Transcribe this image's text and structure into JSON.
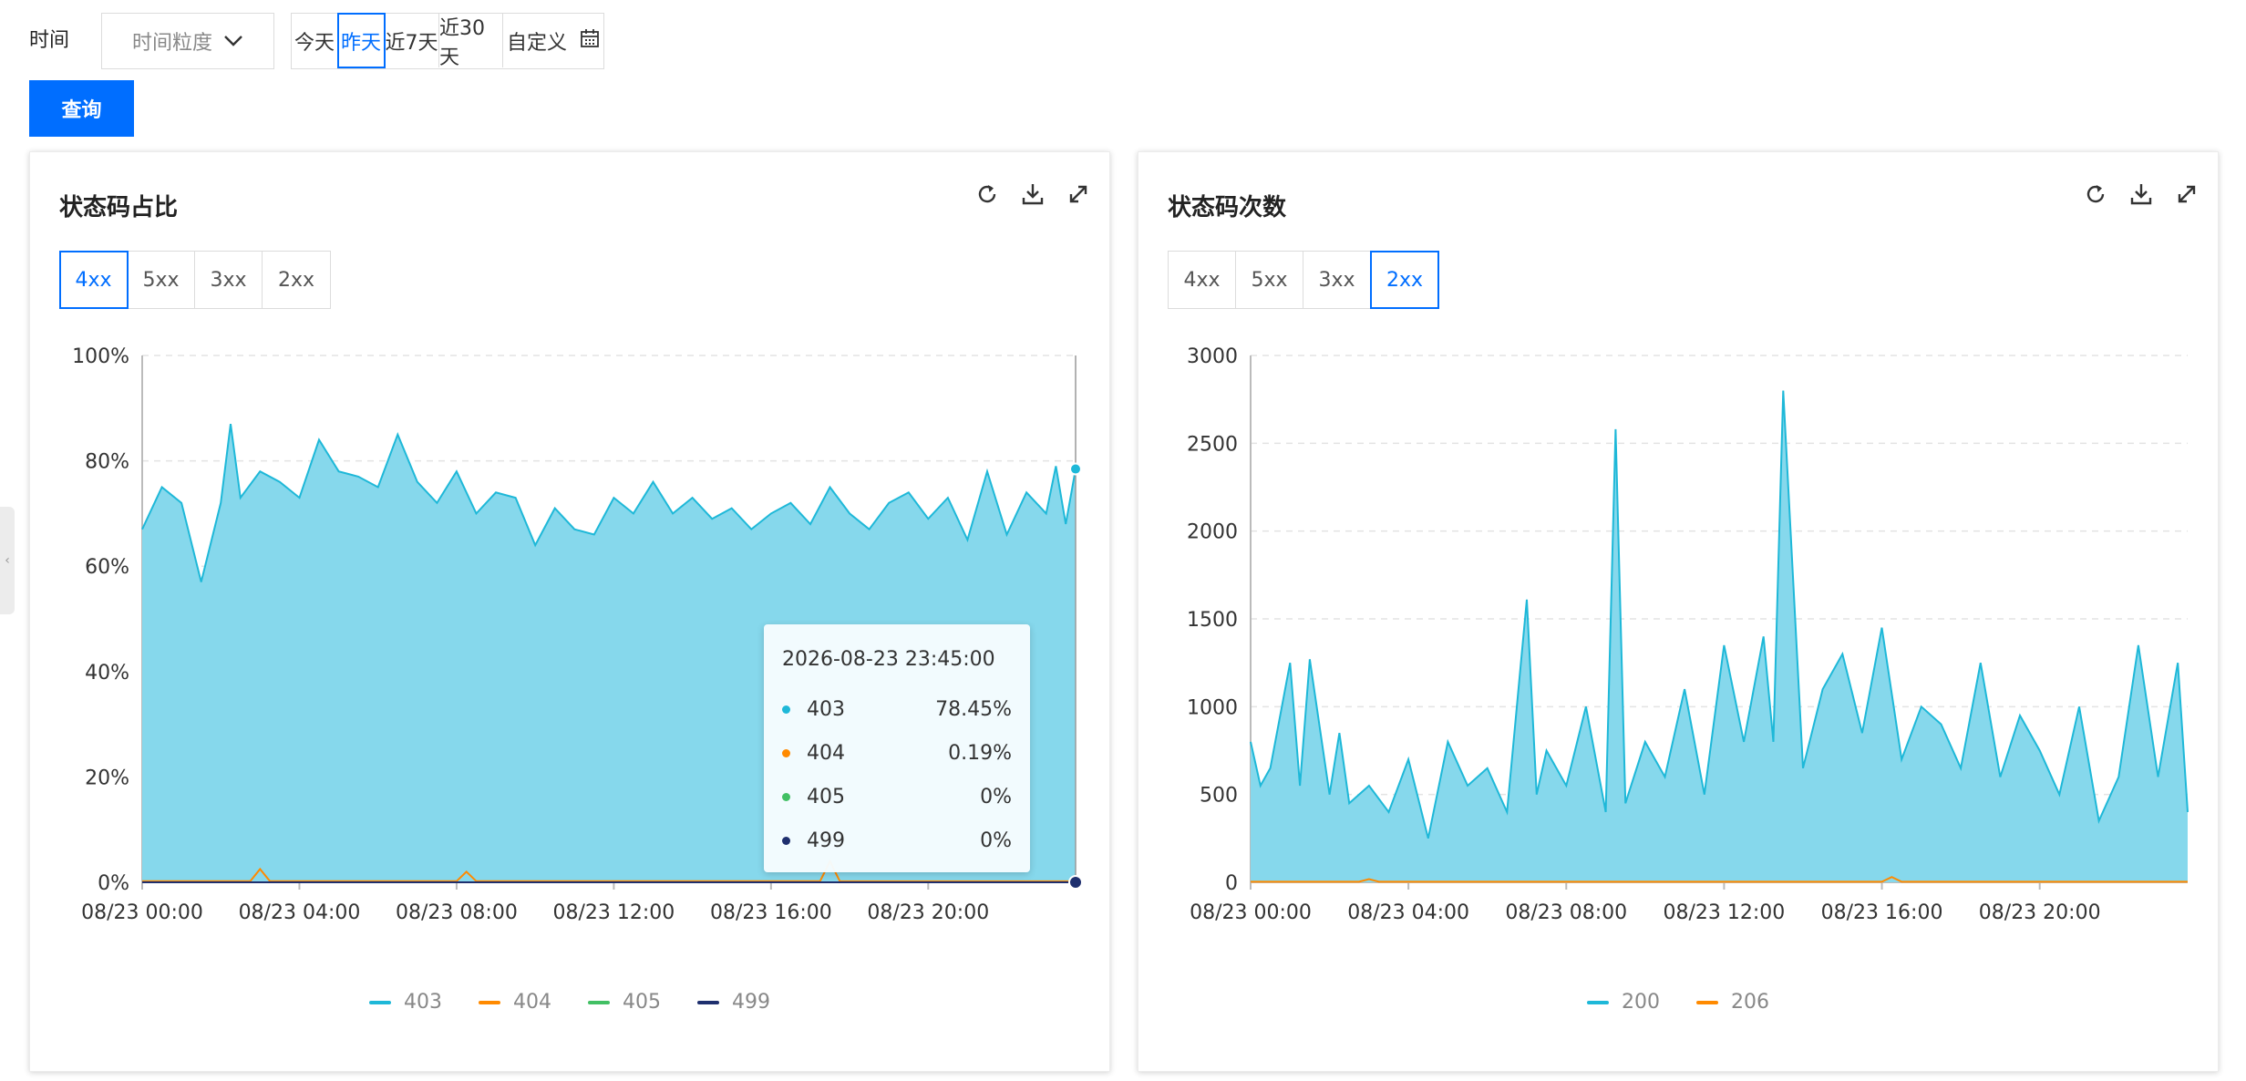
{
  "filters": {
    "time_label": "时间",
    "granularity_placeholder": "时间粒度",
    "ranges": [
      "今天",
      "昨天",
      "近7天",
      "近30天"
    ],
    "active_range": "昨天",
    "custom_label": "自定义",
    "query_label": "查询"
  },
  "colors": {
    "primary": "#006eff",
    "series_403_200": "#1eb8d8",
    "area_fill": "#86d8ec",
    "series_404_206": "#ff8a00",
    "series_405": "#42c064",
    "series_499": "#1e2f6e"
  },
  "left_panel": {
    "title": "状态码占比",
    "tabs": [
      "4xx",
      "5xx",
      "3xx",
      "2xx"
    ],
    "active_tab": "4xx",
    "tools": [
      "refresh-icon",
      "download-icon",
      "fullscreen-icon"
    ],
    "tooltip": {
      "title": "2026-08-23 23:45:00",
      "rows": [
        {
          "name": "403",
          "value": "78.45%",
          "color": "#1eb8d8"
        },
        {
          "name": "404",
          "value": "0.19%",
          "color": "#ff8a00"
        },
        {
          "name": "405",
          "value": "0%",
          "color": "#42c064"
        },
        {
          "name": "499",
          "value": "0%",
          "color": "#1e2f6e"
        }
      ]
    }
  },
  "right_panel": {
    "title": "状态码次数",
    "tabs": [
      "4xx",
      "5xx",
      "3xx",
      "2xx"
    ],
    "active_tab": "2xx",
    "tools": [
      "refresh-icon",
      "download-icon",
      "fullscreen-icon"
    ]
  },
  "chart_data": [
    {
      "type": "area",
      "title": "状态码占比",
      "y_tick_labels": [
        "0%",
        "20%",
        "40%",
        "60%",
        "80%",
        "100%"
      ],
      "ylim": [
        0,
        100
      ],
      "y_unit": "%",
      "x_tick_labels": [
        "08/23 00:00",
        "08/23 04:00",
        "08/23 08:00",
        "08/23 12:00",
        "08/23 16:00",
        "08/23 20:00"
      ],
      "x_range_hours": [
        0,
        23.75
      ],
      "grid": "horizontal-dashed",
      "legend_position": "bottom",
      "series": [
        {
          "name": "403",
          "color": "#1eb8d8",
          "fill": "#86d8ec",
          "x_hours": [
            0,
            0.5,
            1,
            1.5,
            2,
            2.25,
            2.5,
            3,
            3.5,
            4,
            4.5,
            5,
            5.5,
            6,
            6.5,
            7,
            7.5,
            8,
            8.5,
            9,
            9.5,
            10,
            10.5,
            11,
            11.5,
            12,
            12.5,
            13,
            13.5,
            14,
            14.5,
            15,
            15.5,
            16,
            16.5,
            17,
            17.5,
            18,
            18.5,
            19,
            19.5,
            20,
            20.5,
            21,
            21.5,
            22,
            22.5,
            23,
            23.25,
            23.5,
            23.75
          ],
          "values": [
            67,
            75,
            72,
            57,
            72,
            87,
            73,
            78,
            76,
            73,
            84,
            78,
            77,
            75,
            85,
            76,
            72,
            78,
            70,
            74,
            73,
            64,
            71,
            67,
            66,
            73,
            70,
            76,
            70,
            73,
            69,
            71,
            67,
            70,
            72,
            68,
            75,
            70,
            67,
            72,
            74,
            69,
            73,
            65,
            78,
            66,
            74,
            70,
            79,
            68,
            78.45
          ]
        },
        {
          "name": "404",
          "color": "#ff8a00",
          "x_hours": [
            0,
            2.75,
            3,
            3.25,
            8,
            8.25,
            8.5,
            17.25,
            17.5,
            17.75,
            23.75
          ],
          "values": [
            0.2,
            0.2,
            2.5,
            0.2,
            0.2,
            2.0,
            0.2,
            0.2,
            4.0,
            0.2,
            0.19
          ]
        },
        {
          "name": "405",
          "color": "#42c064",
          "x_hours": [
            0,
            23.75
          ],
          "values": [
            0,
            0
          ]
        },
        {
          "name": "499",
          "color": "#1e2f6e",
          "x_hours": [
            0,
            23.75
          ],
          "values": [
            0,
            0
          ]
        }
      ]
    },
    {
      "type": "area",
      "title": "状态码次数",
      "y_tick_labels": [
        "0",
        "500",
        "1000",
        "1500",
        "2000",
        "2500",
        "3000"
      ],
      "ylim": [
        0,
        3000
      ],
      "x_tick_labels": [
        "08/23 00:00",
        "08/23 04:00",
        "08/23 08:00",
        "08/23 12:00",
        "08/23 16:00",
        "08/23 20:00"
      ],
      "x_range_hours": [
        0,
        23.75
      ],
      "grid": "horizontal-dashed",
      "legend_position": "bottom",
      "series": [
        {
          "name": "200",
          "color": "#1eb8d8",
          "fill": "#86d8ec",
          "x_hours": [
            0,
            0.25,
            0.5,
            1,
            1.25,
            1.5,
            2,
            2.25,
            2.5,
            3,
            3.5,
            4,
            4.5,
            5,
            5.5,
            6,
            6.5,
            7,
            7.25,
            7.5,
            8,
            8.5,
            9,
            9.25,
            9.5,
            10,
            10.5,
            11,
            11.5,
            12,
            12.5,
            13,
            13.25,
            13.5,
            14,
            14.5,
            15,
            15.5,
            16,
            16.5,
            17,
            17.5,
            18,
            18.5,
            19,
            19.5,
            20,
            20.5,
            21,
            21.5,
            22,
            22.5,
            23,
            23.5,
            23.75
          ],
          "values": [
            800,
            550,
            650,
            1250,
            550,
            1270,
            500,
            850,
            450,
            550,
            400,
            700,
            250,
            800,
            550,
            650,
            400,
            1610,
            500,
            750,
            550,
            1000,
            400,
            2580,
            450,
            800,
            600,
            1100,
            500,
            1350,
            800,
            1400,
            800,
            2800,
            650,
            1100,
            1300,
            850,
            1450,
            700,
            1000,
            900,
            650,
            1250,
            600,
            950,
            750,
            500,
            1000,
            350,
            600,
            1350,
            600,
            1250,
            400
          ]
        },
        {
          "name": "206",
          "color": "#ff8a00",
          "x_hours": [
            0,
            2.75,
            3,
            3.25,
            16,
            16.25,
            16.5,
            23.75
          ],
          "values": [
            3,
            3,
            18,
            3,
            3,
            30,
            3,
            3
          ]
        }
      ]
    }
  ]
}
